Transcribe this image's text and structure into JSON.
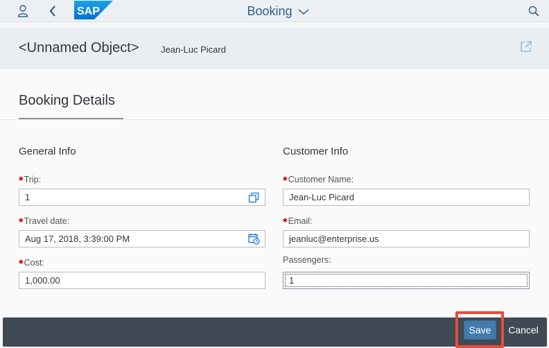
{
  "shell": {
    "title": "Booking",
    "logo_text": "SAP",
    "brand_color": "#0a6ed1",
    "icons": [
      "person-icon",
      "back-icon",
      "chevron-down-icon",
      "search-icon"
    ]
  },
  "header": {
    "title": "<Unnamed Object>",
    "subtitle": "Jean-Luc Picard",
    "share_icon": "share-icon"
  },
  "section": {
    "title": "Booking Details"
  },
  "general": {
    "title": "General Info",
    "trip_label": "Trip:",
    "trip_value": "1",
    "travel_date_label": "Travel date:",
    "travel_date_value": "Aug 17, 2018, 3:39:00 PM",
    "cost_label": "Cost:",
    "cost_value": "1,000.00"
  },
  "customer": {
    "title": "Customer Info",
    "name_label": "Customer Name:",
    "name_value": "Jean-Luc Picard",
    "email_label": "Email:",
    "email_value": "jeanluc@enterprise.us",
    "passengers_label": "Passengers:",
    "passengers_value": "1"
  },
  "required_marker": "*",
  "footer": {
    "save_label": "Save",
    "cancel_label": "Cancel",
    "highlight_color": "#e84c3d"
  }
}
